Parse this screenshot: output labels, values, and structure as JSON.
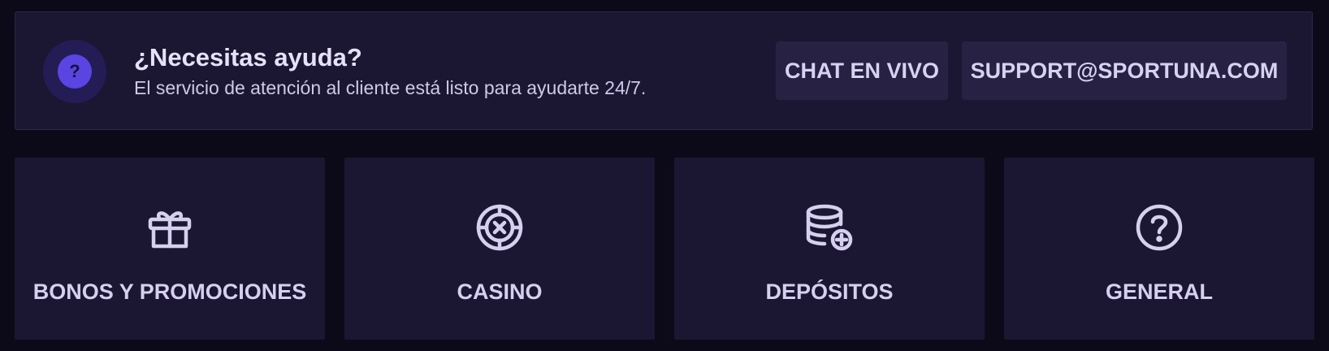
{
  "help": {
    "icon": "question-icon",
    "icon_glyph": "?",
    "title": "¿Necesitas ayuda?",
    "subtitle": "El servicio de atención al cliente está listo para ayudarte 24/7.",
    "chat_label": "CHAT EN VIVO",
    "email_label": "SUPPORT@SPORTUNA.COM"
  },
  "categories": [
    {
      "label": "BONOS Y PROMOCIONES",
      "icon": "gift-icon"
    },
    {
      "label": "CASINO",
      "icon": "roulette-icon"
    },
    {
      "label": "DEPÓSITOS",
      "icon": "coins-plus-icon"
    },
    {
      "label": "GENERAL",
      "icon": "question-circle-icon"
    }
  ],
  "colors": {
    "background": "#0c0a18",
    "panel": "#1b1732",
    "button": "#272243",
    "accent": "#5b45e2",
    "text": "#d6d0ee"
  }
}
